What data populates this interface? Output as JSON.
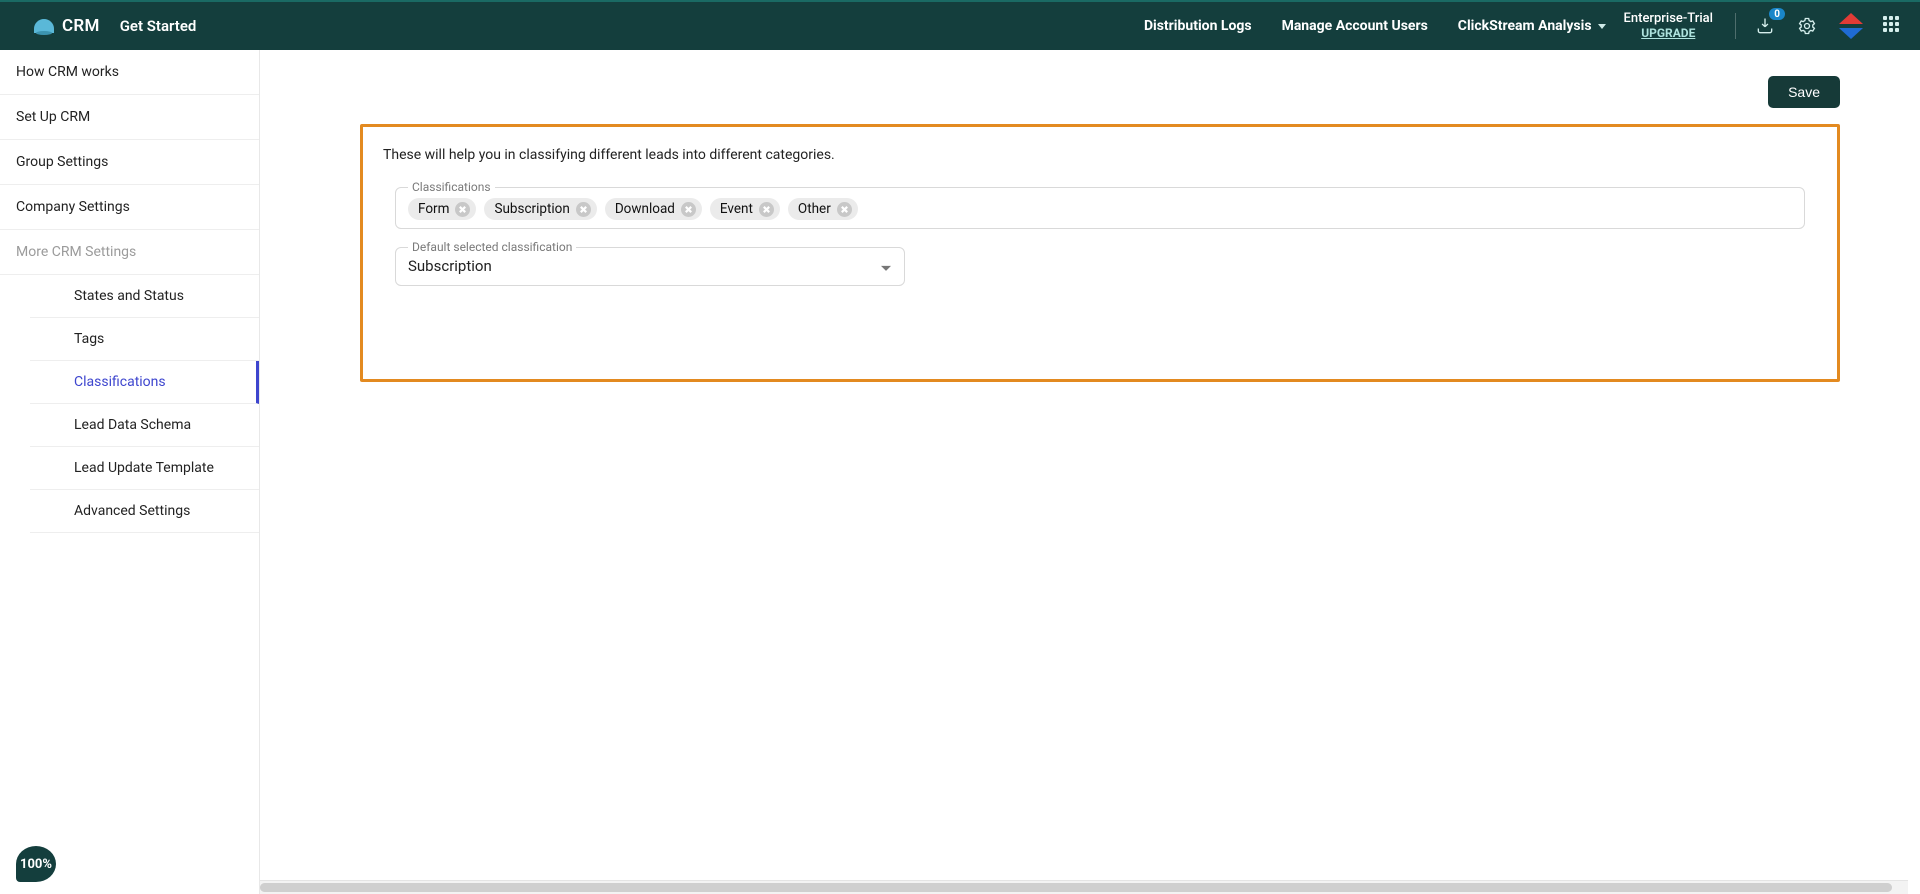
{
  "header": {
    "brand": "CRM",
    "getStarted": "Get Started",
    "menu": {
      "distributionLogs": "Distribution Logs",
      "manageUsers": "Manage Account Users",
      "clickstream": "ClickStream Analysis"
    },
    "plan": "Enterprise-Trial",
    "upgrade": "UPGRADE",
    "notificationCount": "0"
  },
  "sidebar": {
    "items": [
      {
        "label": "How CRM works"
      },
      {
        "label": "Set Up CRM"
      },
      {
        "label": "Group Settings"
      },
      {
        "label": "Company Settings"
      }
    ],
    "sectionLabel": "More CRM Settings",
    "subitems": [
      {
        "label": "States and Status"
      },
      {
        "label": "Tags"
      },
      {
        "label": "Classifications"
      },
      {
        "label": "Lead Data Schema"
      },
      {
        "label": "Lead Update Template"
      },
      {
        "label": "Advanced Settings"
      }
    ]
  },
  "toolbar": {
    "save": "Save"
  },
  "panel": {
    "description": "These will help you in classifying different leads into different categories.",
    "classificationsLabel": "Classifications",
    "chips": [
      "Form",
      "Subscription",
      "Download",
      "Event",
      "Other"
    ],
    "defaultLabel": "Default selected classification",
    "defaultValue": "Subscription"
  },
  "zoom": "100%"
}
